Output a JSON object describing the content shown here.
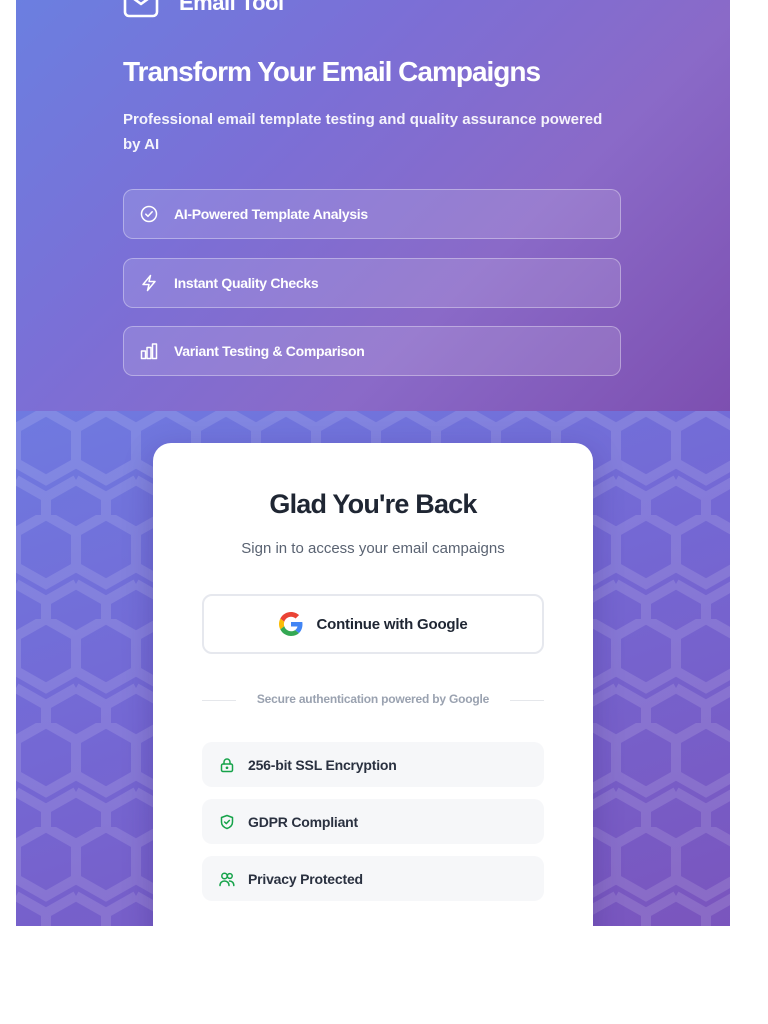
{
  "brand": {
    "name": "Email Tool",
    "icon": "mail-icon"
  },
  "hero": {
    "title": "Transform Your Email Campaigns",
    "subtitle": "Professional email template testing and quality assurance powered by AI",
    "features": [
      {
        "label": "AI-Powered Template Analysis",
        "icon": "check-circle-icon"
      },
      {
        "label": "Instant Quality Checks",
        "icon": "lightning-icon"
      },
      {
        "label": "Variant Testing & Comparison",
        "icon": "bar-chart-icon"
      }
    ]
  },
  "login": {
    "title": "Glad You're Back",
    "subtitle": "Sign in to access your email campaigns",
    "google_button_label": "Continue with Google",
    "divider_text": "Secure authentication powered by Google",
    "trust_items": [
      {
        "label": "256-bit SSL Encryption",
        "icon": "lock-icon"
      },
      {
        "label": "GDPR Compliant",
        "icon": "shield-check-icon"
      },
      {
        "label": "Privacy Protected",
        "icon": "users-icon"
      }
    ]
  },
  "colors": {
    "hero_gradient_start": "#6b7fe0",
    "hero_gradient_end": "#7d4fb0",
    "trust_icon_green": "#16a34a",
    "title_dark": "#1f2633"
  }
}
